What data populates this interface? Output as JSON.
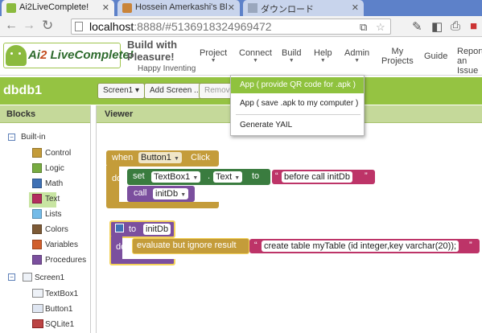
{
  "browser": {
    "tabs": [
      {
        "title": "Ai2LiveComplete!",
        "active": true
      },
      {
        "title": "Hossein Amerkashi's Bl",
        "active": false
      },
      {
        "title": "ダウンロード",
        "active": false
      }
    ],
    "url_host": "localhost",
    "url_path": ":8888/#5136918324969472",
    "icons": [
      "back-icon",
      "forward-icon",
      "reload-icon",
      "star-icon",
      "pen-icon",
      "puzzle-icon",
      "print-icon"
    ]
  },
  "header": {
    "logo": {
      "prefix": "Ai",
      "two": "2",
      "suffix": " LiveComplete!"
    },
    "slogan_line1": "Build with",
    "slogan_line2": "Pleasure!",
    "slogan_sub": "Happy Inventing",
    "menus": [
      {
        "label": "Project",
        "caret": "▼"
      },
      {
        "label": "Connect",
        "caret": "▼"
      },
      {
        "label": "Build",
        "caret": "▼"
      },
      {
        "label": "Help",
        "caret": "▼"
      },
      {
        "label": "Admin",
        "caret": "▼"
      },
      {
        "label": "My\nProjects",
        "caret": ""
      },
      {
        "label": "Guide",
        "caret": ""
      },
      {
        "label": "Report\nan\nIssue",
        "caret": ""
      }
    ]
  },
  "project": {
    "name": "dbdb1",
    "screen_button": "Screen1 ▾",
    "add_screen_button": "Add Screen ...",
    "remove_button": "Remove"
  },
  "build_menu": {
    "items": [
      "App ( provide QR code for .apk )",
      "App ( save .apk to my computer )",
      "Generate YAIL"
    ],
    "highlighted_index": 0
  },
  "blocks_panel": {
    "title": "Blocks",
    "builtin_label": "Built-in",
    "builtin_toggle": "−",
    "builtin": [
      {
        "label": "Control",
        "color": "#c49c3a"
      },
      {
        "label": "Logic",
        "color": "#77ab41"
      },
      {
        "label": "Math",
        "color": "#3f71b5"
      },
      {
        "label": "Text",
        "color": "#b32d5e"
      },
      {
        "label": "Lists",
        "color": "#74bbe8"
      },
      {
        "label": "Colors",
        "color": "#7d5a36"
      },
      {
        "label": "Variables",
        "color": "#d05f2d"
      },
      {
        "label": "Procedures",
        "color": "#7b4f9e"
      }
    ],
    "selected": "Text",
    "screen_label": "Screen1",
    "screen_toggle": "−",
    "components": [
      "TextBox1",
      "Button1",
      "SQLite1"
    ]
  },
  "viewer": {
    "title": "Viewer",
    "event_block": {
      "when": "when",
      "component": "Button1",
      "event": "Click",
      "do": "do",
      "set": "set",
      "set_component": "TextBox1",
      "dot": ".",
      "property": "Text",
      "to": "to",
      "string_value": "before call initDb",
      "call": "call",
      "call_target": "initDb"
    },
    "procedure_block": {
      "to": "to",
      "name": "initDb",
      "do": "do",
      "evaluate": "evaluate but ignore result",
      "string_value": "create table myTable (id integer,key varchar(20));"
    },
    "colors": {
      "control": "#c49c3a",
      "component_green": "#3a7c3f",
      "text_pink": "#bd3468",
      "procedure_purple": "#7b4f9e"
    }
  }
}
